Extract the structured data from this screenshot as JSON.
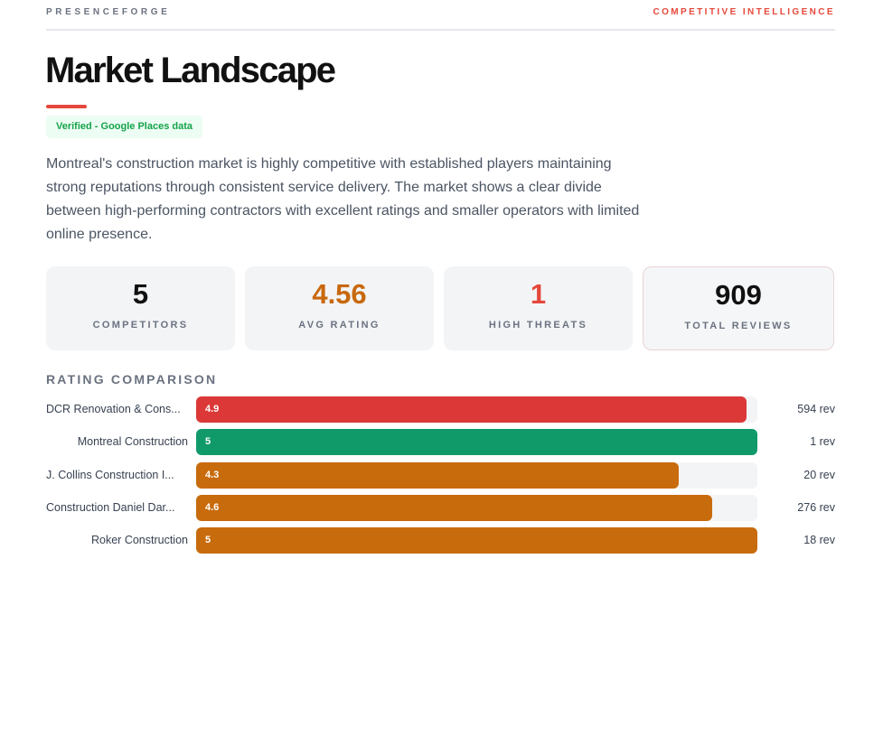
{
  "header": {
    "brand": "PRESENCEFORGE",
    "section": "COMPETITIVE INTELLIGENCE"
  },
  "page": {
    "title": "Market Landscape",
    "badge": "Verified - Google Places data",
    "summary": "Montreal's construction market is highly competitive with established players maintaining strong reputations through consistent service delivery. The market shows a clear divide between high-performing contractors with excellent ratings and smaller operators with limited online presence."
  },
  "stats": [
    {
      "value": "5",
      "label": "COMPETITORS",
      "color": "#111111"
    },
    {
      "value": "4.56",
      "label": "AVG RATING",
      "color": "#c8680d"
    },
    {
      "value": "1",
      "label": "HIGH THREATS",
      "color": "#e5483b"
    },
    {
      "value": "909",
      "label": "TOTAL REVIEWS",
      "color": "#111111"
    }
  ],
  "chart_data": {
    "type": "bar",
    "title": "RATING COMPARISON",
    "categories": [
      "DCR Renovation & Cons...",
      "Montreal Construction",
      "J. Collins Construction I...",
      "Construction Daniel Dar...",
      "Roker Construction"
    ],
    "values": [
      4.9,
      5,
      4.3,
      4.6,
      5
    ],
    "value_labels": [
      "4.9",
      "5",
      "4.3",
      "4.6",
      "5"
    ],
    "reviews": [
      "594 rev",
      "1 rev",
      "20 rev",
      "276 rev",
      "18 rev"
    ],
    "colors": [
      "#dc3838",
      "#109a6a",
      "#c86b0c",
      "#c86b0c",
      "#c86b0c"
    ],
    "ylim": [
      0,
      5
    ],
    "orientation": "horizontal"
  }
}
